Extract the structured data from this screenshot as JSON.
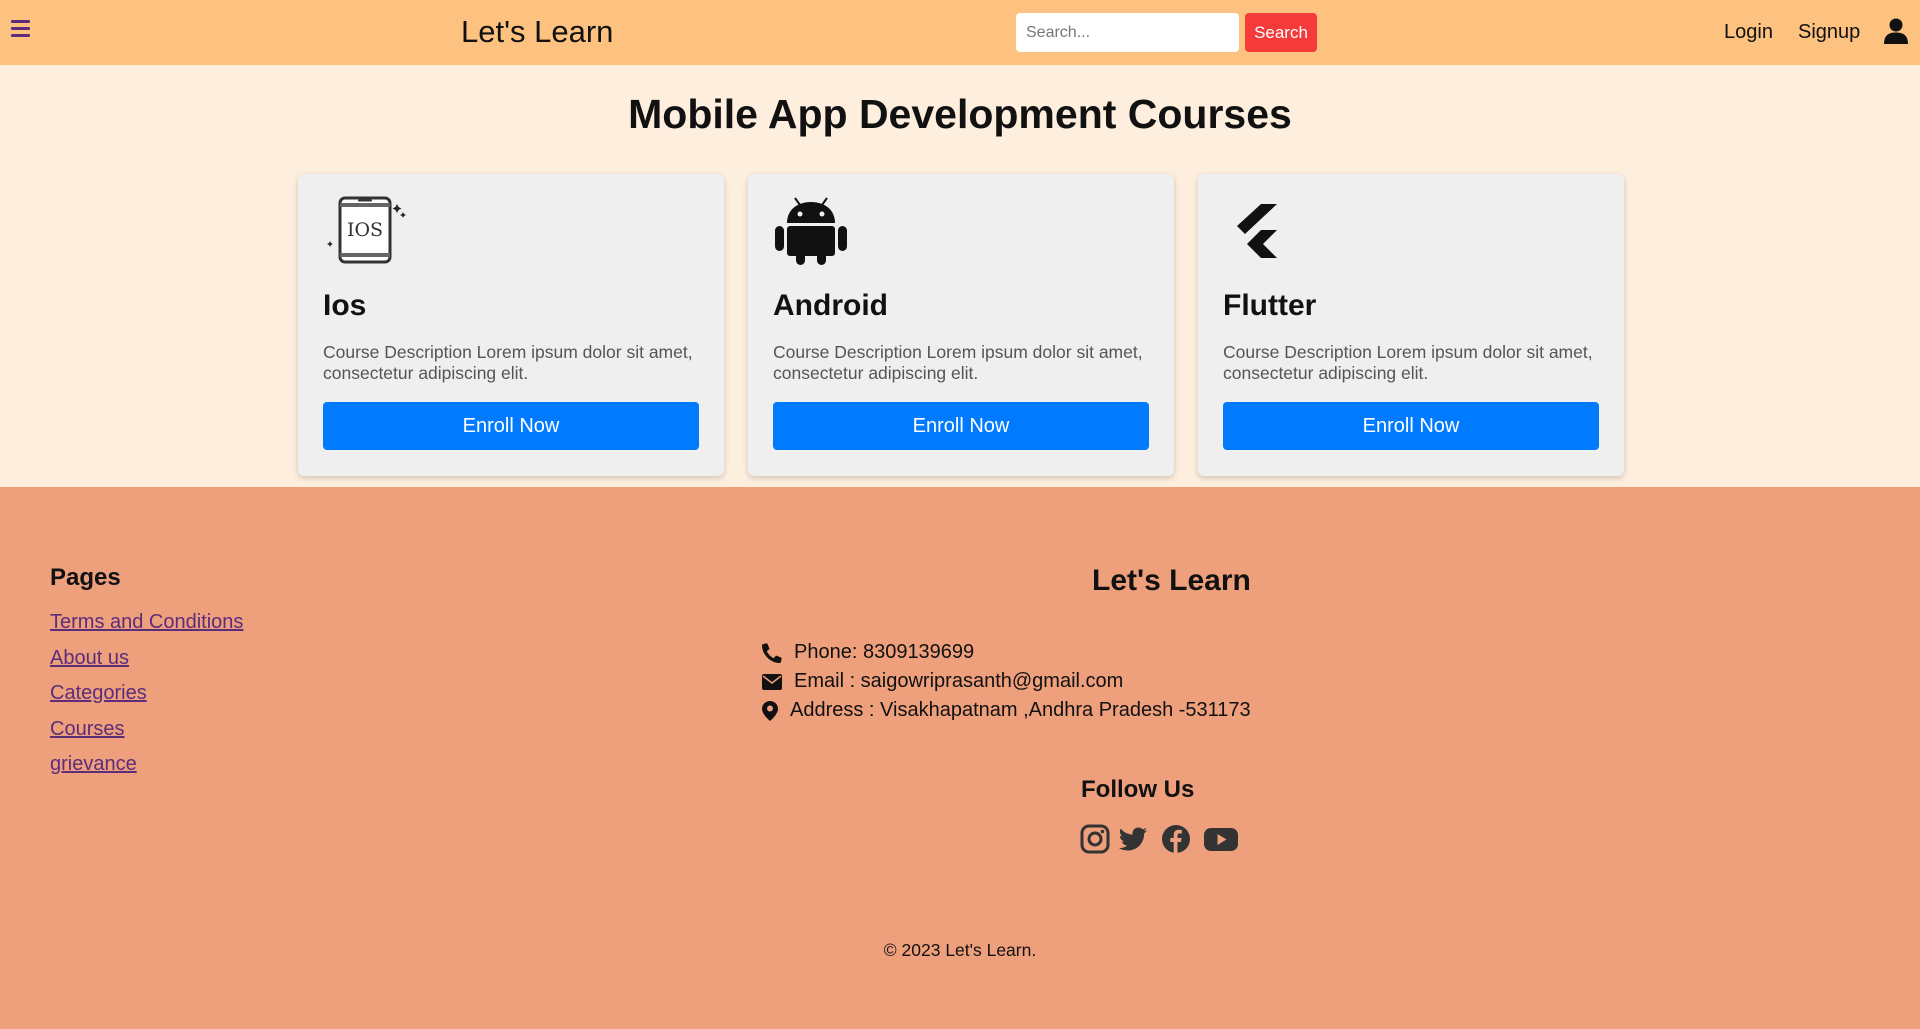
{
  "header": {
    "brand": "Let's Learn",
    "search_placeholder": "Search...",
    "search_label": "Search",
    "login_label": "Login",
    "signup_label": "Signup"
  },
  "main": {
    "title": "Mobile App Development Courses",
    "cards": [
      {
        "title": "Ios",
        "description": "Course Description Lorem ipsum dolor sit amet, consectetur adipiscing elit.",
        "button": "Enroll Now",
        "icon": "ios-phone-icon"
      },
      {
        "title": "Android",
        "description": "Course Description Lorem ipsum dolor sit amet, consectetur adipiscing elit.",
        "button": "Enroll Now",
        "icon": "android-icon"
      },
      {
        "title": "Flutter",
        "description": "Course Description Lorem ipsum dolor sit amet, consectetur adipiscing elit.",
        "button": "Enroll Now",
        "icon": "flutter-icon"
      }
    ]
  },
  "footer": {
    "pages_title": "Pages",
    "links": [
      "Terms and Conditions",
      "About us",
      "Categories",
      "Courses",
      "grievance"
    ],
    "brand": "Let's Learn",
    "phone": "Phone: 8309139699",
    "email": "Email : saigowriprasanth@gmail.com",
    "address": "Address : Visakhapatnam ,Andhra Pradesh -531173",
    "follow_title": "Follow Us",
    "socials": [
      "instagram-icon",
      "twitter-icon",
      "facebook-icon",
      "youtube-icon"
    ],
    "copyright": "© 2023 Let's Learn."
  },
  "colors": {
    "header_bg": "#fdc180",
    "main_bg": "#fdeedd",
    "footer_bg": "#ee9f7c",
    "search_button": "#f53a3a",
    "enroll_button": "#007bff",
    "link": "#5b2d7a"
  }
}
